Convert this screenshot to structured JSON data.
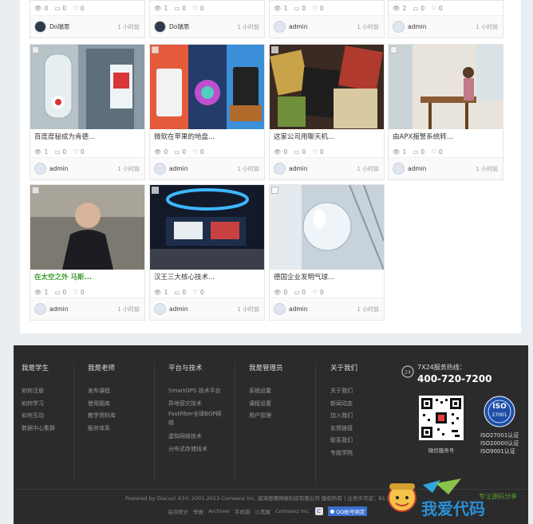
{
  "cards_top_row": [
    {
      "views": "0",
      "comments": "0",
      "likes": "0",
      "author": "Do瑞思",
      "time": "1 小时前"
    },
    {
      "views": "1",
      "comments": "0",
      "likes": "0",
      "author": "Do瑞思",
      "time": "1 小时前"
    },
    {
      "views": "1",
      "comments": "0",
      "likes": "0",
      "author": "admin",
      "time": "1 小时前"
    },
    {
      "views": "2",
      "comments": "0",
      "likes": "0",
      "author": "admin",
      "time": "1 小时前"
    }
  ],
  "cards_row2": [
    {
      "title": "百度度秘成为肯德...",
      "views": "1",
      "comments": "0",
      "likes": "0",
      "author": "admin",
      "time": "1 小时前"
    },
    {
      "title": "微软在苹果的地盘...",
      "views": "0",
      "comments": "0",
      "likes": "0",
      "author": "admin",
      "time": "1 小时前"
    },
    {
      "title": "这家公司用聊天机...",
      "views": "0",
      "comments": "0",
      "likes": "0",
      "author": "admin",
      "time": "1 小时前"
    },
    {
      "title": "由APX报警系统转...",
      "views": "1",
      "comments": "0",
      "likes": "0",
      "author": "admin",
      "time": "1 小时前"
    }
  ],
  "cards_row3": [
    {
      "title": "在太空之外 马斯...",
      "views": "1",
      "comments": "0",
      "likes": "0",
      "author": "admin",
      "time": "1 小时前"
    },
    {
      "title": "汉王三大核心技术...",
      "views": "1",
      "comments": "0",
      "likes": "0",
      "author": "admin",
      "time": "1 小时前"
    },
    {
      "title": "德国企业发明气球...",
      "views": "0",
      "comments": "0",
      "likes": "0",
      "author": "admin",
      "time": "1 小时前"
    }
  ],
  "footer": {
    "col1": {
      "heading": "我是学生",
      "links": [
        "如何注册",
        "如何学习",
        "如何互动",
        "数据中心集群"
      ]
    },
    "col2": {
      "heading": "我是老师",
      "links": [
        "发布课程",
        "使用题库",
        "教学资料库",
        "服务体系"
      ]
    },
    "col3": {
      "heading": "平台与技术",
      "links": [
        "SmartOPS 技术平台",
        "异地容灾技术",
        "FastFiber全球BGP网",
        "络",
        "虚拟网络技术",
        "分布式存储技术"
      ]
    },
    "col4": {
      "heading": "我是管理员",
      "links": [
        "系统设置",
        "课程设置",
        "用户管理"
      ]
    },
    "col5": {
      "heading": "关于我们",
      "links": [
        "关于我们",
        "新闻动态",
        "加入我们",
        "友情链接",
        "联系我们",
        "专题学院"
      ]
    },
    "hotline_label": "7X24服务热线：",
    "hotline_number": "400-720-7200",
    "qr_caption": "微信服务号",
    "iso_badge": "ISO",
    "iso_badge_num": "27001",
    "iso_lines": [
      "ISO27001认证",
      "ISO20000认证",
      "ISO9001认证"
    ],
    "copyright": "Powered by Discuz! X3© 2001-2013 Comsenz Inc.  威海德赛网络科技有限公司 版权所有  | 业务许可证：B1.B",
    "bottom_links": [
      "站点统计",
      "举报",
      "Archiver",
      "手机版",
      "小黑屋",
      "Comsenz Inc."
    ],
    "qq_label": "QQ帐号绑定"
  },
  "watermark": {
    "text": "我爱代码",
    "subtext": "专注源码分享"
  },
  "colors": {
    "accent_green": "#3c9a2c",
    "footer_bg": "#2b2b2b",
    "page_bg": "#e8eef2"
  }
}
